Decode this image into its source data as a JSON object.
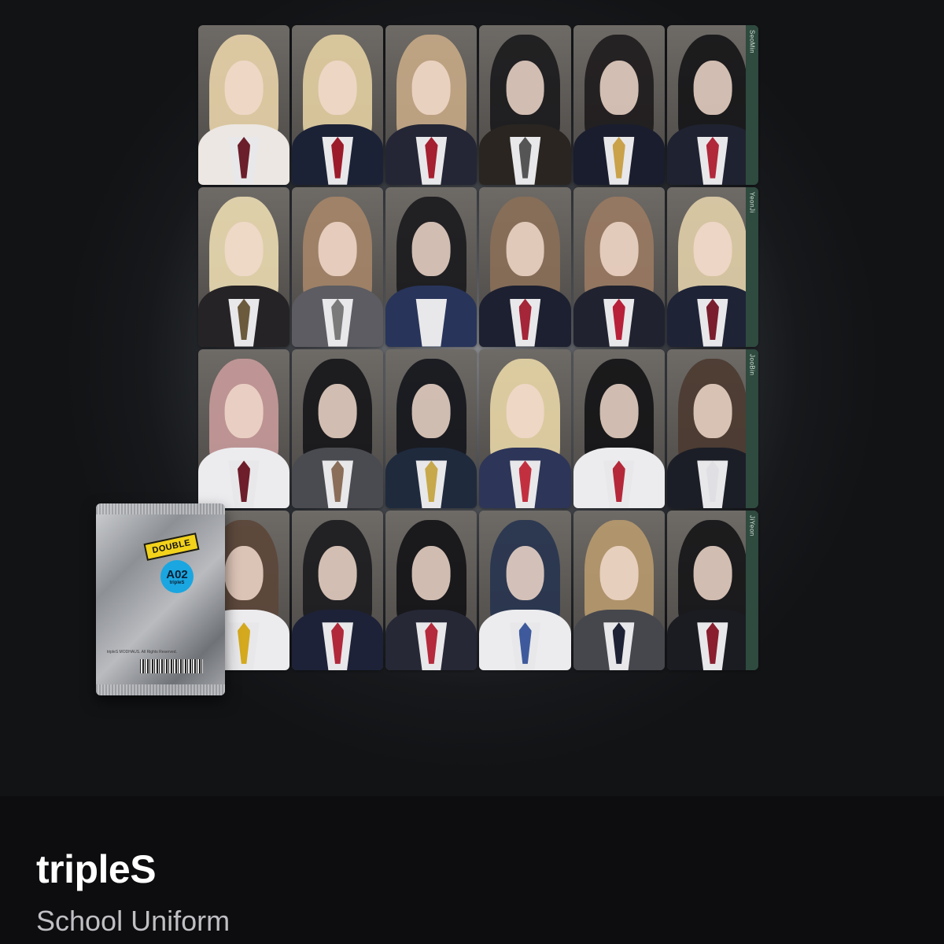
{
  "product": {
    "artist": "tripleS",
    "name": "School Uniform"
  },
  "pack": {
    "label": "DOUBLE",
    "code": "A02",
    "sub": "tripleS",
    "fineprint": "tripleS MODHAUS. All Rights Reserved."
  },
  "cards": [
    {
      "hair": "#e8d3a8",
      "uniform": "#ece7e2",
      "tie": "#6b1f2a",
      "tab": ""
    },
    {
      "hair": "#e3cfa2",
      "uniform": "#1c2236",
      "tie": "#9c1b2a",
      "tab": ""
    },
    {
      "hair": "#c7aa86",
      "uniform": "#242635",
      "tie": "#a52030",
      "tab": ""
    },
    {
      "hair": "#1a1a1c",
      "uniform": "#2a2520",
      "tie": "#555555",
      "tab": ""
    },
    {
      "hair": "#1e1b1d",
      "uniform": "#1a1d2d",
      "tie": "#c9a24a",
      "tab": ""
    },
    {
      "hair": "#141416",
      "uniform": "#1f2230",
      "tie": "#b0283a",
      "tab": "SeoMin"
    },
    {
      "hair": "#eadab0",
      "uniform": "#262326",
      "tie": "#6b5a3c",
      "tab": ""
    },
    {
      "hair": "#a58568",
      "uniform": "#5c5c62",
      "tie": "#7a7a7a",
      "tab": ""
    },
    {
      "hair": "#1a1a1d",
      "uniform": "#28345a",
      "tie": "#e8e8ea",
      "tab": ""
    },
    {
      "hair": "#8a6f58",
      "uniform": "#1d2030",
      "tie": "#a42638",
      "tab": ""
    },
    {
      "hair": "#9a7a62",
      "uniform": "#20232f",
      "tie": "#b8203a",
      "tab": ""
    },
    {
      "hair": "#e1cfa8",
      "uniform": "#1e2336",
      "tie": "#7a1e2e",
      "tab": "YeonJi"
    },
    {
      "hair": "#c89a9a",
      "uniform": "#ececef",
      "tie": "#6e1d2a",
      "tab": ""
    },
    {
      "hair": "#151518",
      "uniform": "#4a4b50",
      "tie": "#8a6e5a",
      "tab": ""
    },
    {
      "hair": "#13151b",
      "uniform": "#1f2a3d",
      "tie": "#c7a84a",
      "tab": ""
    },
    {
      "hair": "#e8d6a6",
      "uniform": "#2d3558",
      "tie": "#c23040",
      "tab": ""
    },
    {
      "hair": "#121214",
      "uniform": "#ececef",
      "tie": "#b5283a",
      "tab": ""
    },
    {
      "hair": "#4b3a30",
      "uniform": "#1c1e27",
      "tie": "#e0e0e4",
      "tab": "JooBin"
    },
    {
      "hair": "#5c4638",
      "uniform": "#ececef",
      "tie": "#d4a91e",
      "tab": ""
    },
    {
      "hair": "#1b1b1e",
      "uniform": "#1d2238",
      "tie": "#b0283a",
      "tab": ""
    },
    {
      "hair": "#121215",
      "uniform": "#262836",
      "tie": "#b52a3c",
      "tab": ""
    },
    {
      "hair": "#27344f",
      "uniform": "#ececef",
      "tie": "#3e5a9c",
      "tab": ""
    },
    {
      "hair": "#b89a6e",
      "uniform": "#46474d",
      "tie": "#1e2235",
      "tab": ""
    },
    {
      "hair": "#141416",
      "uniform": "#1b1c22",
      "tie": "#8a1e2e",
      "tab": "JiYeon"
    }
  ]
}
